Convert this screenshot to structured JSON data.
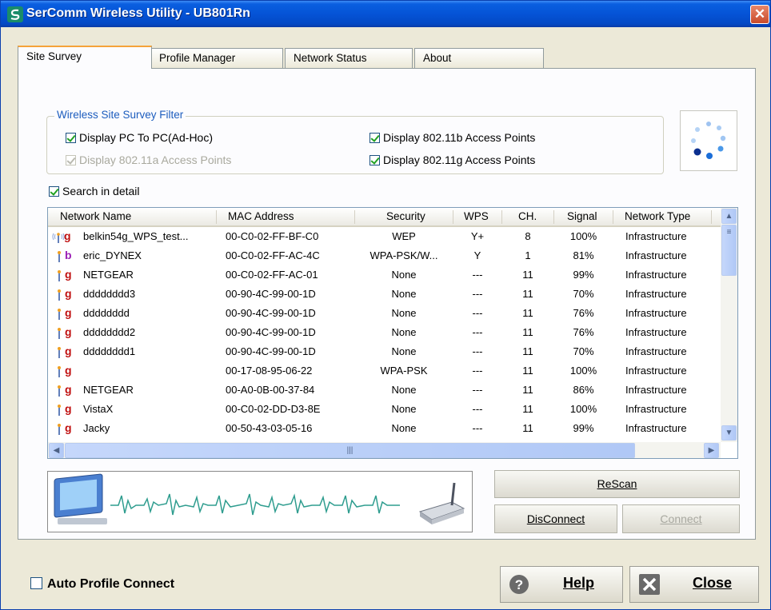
{
  "window": {
    "title": "SerComm Wireless Utility - UB801Rn",
    "close_glyph": "✕"
  },
  "tabs": [
    {
      "label": "Site Survey",
      "active": true
    },
    {
      "label": "Profile Manager",
      "active": false
    },
    {
      "label": "Network Status",
      "active": false
    },
    {
      "label": "About",
      "active": false
    }
  ],
  "filter": {
    "legend": "Wireless Site Survey Filter",
    "options": [
      {
        "label": "Display PC To PC(Ad-Hoc)",
        "checked": true,
        "enabled": true
      },
      {
        "label": "Display 802.11a Access Points",
        "checked": true,
        "enabled": false
      },
      {
        "label": "Display 802.11b Access Points",
        "checked": true,
        "enabled": true
      },
      {
        "label": "Display 802.11g Access Points",
        "checked": true,
        "enabled": true
      }
    ]
  },
  "search_detail": {
    "label": "Search in detail",
    "checked": true
  },
  "table": {
    "columns": [
      "Network Name",
      "MAC Address",
      "Security",
      "WPS",
      "CH.",
      "Signal",
      "Network Type"
    ],
    "rows": [
      {
        "icon": "wps-antenna-icon",
        "band": "g",
        "name": "belkin54g_WPS_test...",
        "mac": "00-C0-02-FF-BF-C0",
        "security": "WEP",
        "wps": "Y+",
        "ch": "8",
        "signal": "100%",
        "type": "Infrastructure"
      },
      {
        "icon": "antenna-icon",
        "band": "b",
        "name": "eric_DYNEX",
        "mac": "00-C0-02-FF-AC-4C",
        "security": "WPA-PSK/W...",
        "wps": "Y",
        "ch": "1",
        "signal": "81%",
        "type": "Infrastructure"
      },
      {
        "icon": "antenna-icon",
        "band": "g",
        "name": "NETGEAR",
        "mac": "00-C0-02-FF-AC-01",
        "security": "None",
        "wps": "---",
        "ch": "11",
        "signal": "99%",
        "type": "Infrastructure"
      },
      {
        "icon": "antenna-icon",
        "band": "g",
        "name": "dddddddd3",
        "mac": "00-90-4C-99-00-1D",
        "security": "None",
        "wps": "---",
        "ch": "11",
        "signal": "70%",
        "type": "Infrastructure"
      },
      {
        "icon": "antenna-icon",
        "band": "g",
        "name": "dddddddd",
        "mac": "00-90-4C-99-00-1D",
        "security": "None",
        "wps": "---",
        "ch": "11",
        "signal": "76%",
        "type": "Infrastructure"
      },
      {
        "icon": "antenna-icon",
        "band": "g",
        "name": "dddddddd2",
        "mac": "00-90-4C-99-00-1D",
        "security": "None",
        "wps": "---",
        "ch": "11",
        "signal": "76%",
        "type": "Infrastructure"
      },
      {
        "icon": "antenna-icon",
        "band": "g",
        "name": "dddddddd1",
        "mac": "00-90-4C-99-00-1D",
        "security": "None",
        "wps": "---",
        "ch": "11",
        "signal": "70%",
        "type": "Infrastructure"
      },
      {
        "icon": "antenna-icon",
        "band": "g",
        "name": "",
        "mac": "00-17-08-95-06-22",
        "security": "WPA-PSK",
        "wps": "---",
        "ch": "11",
        "signal": "100%",
        "type": "Infrastructure"
      },
      {
        "icon": "antenna-icon",
        "band": "g",
        "name": "NETGEAR",
        "mac": "00-A0-0B-00-37-84",
        "security": "None",
        "wps": "---",
        "ch": "11",
        "signal": "86%",
        "type": "Infrastructure"
      },
      {
        "icon": "antenna-icon",
        "band": "g",
        "name": "VistaX",
        "mac": "00-C0-02-DD-D3-8E",
        "security": "None",
        "wps": "---",
        "ch": "11",
        "signal": "100%",
        "type": "Infrastructure"
      },
      {
        "icon": "antenna-icon",
        "band": "g",
        "name": "Jacky",
        "mac": "00-50-43-03-05-16",
        "security": "None",
        "wps": "---",
        "ch": "11",
        "signal": "99%",
        "type": "Infrastructure"
      }
    ]
  },
  "actions": {
    "rescan": "ReScan",
    "disconnect": "DisConnect",
    "connect": "Connect"
  },
  "bottom": {
    "auto_profile_label": "Auto Profile Connect",
    "auto_profile_checked": false,
    "help_label": "Help",
    "close_label": "Close"
  },
  "colors": {
    "title_bar": "#0553d6",
    "band_g": "#c01010",
    "band_b": "#9b1fb5",
    "waveform": "#2f9d8f",
    "active_tab_accent": "#f5a33a"
  }
}
